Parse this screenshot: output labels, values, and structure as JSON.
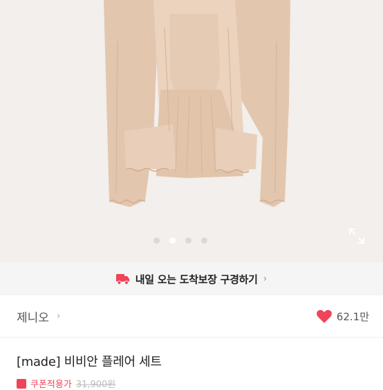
{
  "gallery": {
    "image_count": 4,
    "active_index": 1,
    "expand_icon": "expand-icon"
  },
  "promo": {
    "icon": "delivery-truck-icon",
    "text": "내일 오는 도착보장 구경하기",
    "chevron": "›"
  },
  "seller": {
    "name": "제니오",
    "chevron": "›",
    "likes": "62.1만",
    "like_icon": "heart-icon"
  },
  "product": {
    "title": "[made] 비비안 플레어 세트",
    "coupon_label": "쿠폰적용가",
    "coupon_price": "31,900원"
  },
  "colors": {
    "accent": "#ef4459",
    "garment": "#e8cdb6",
    "background": "#f2efec"
  }
}
